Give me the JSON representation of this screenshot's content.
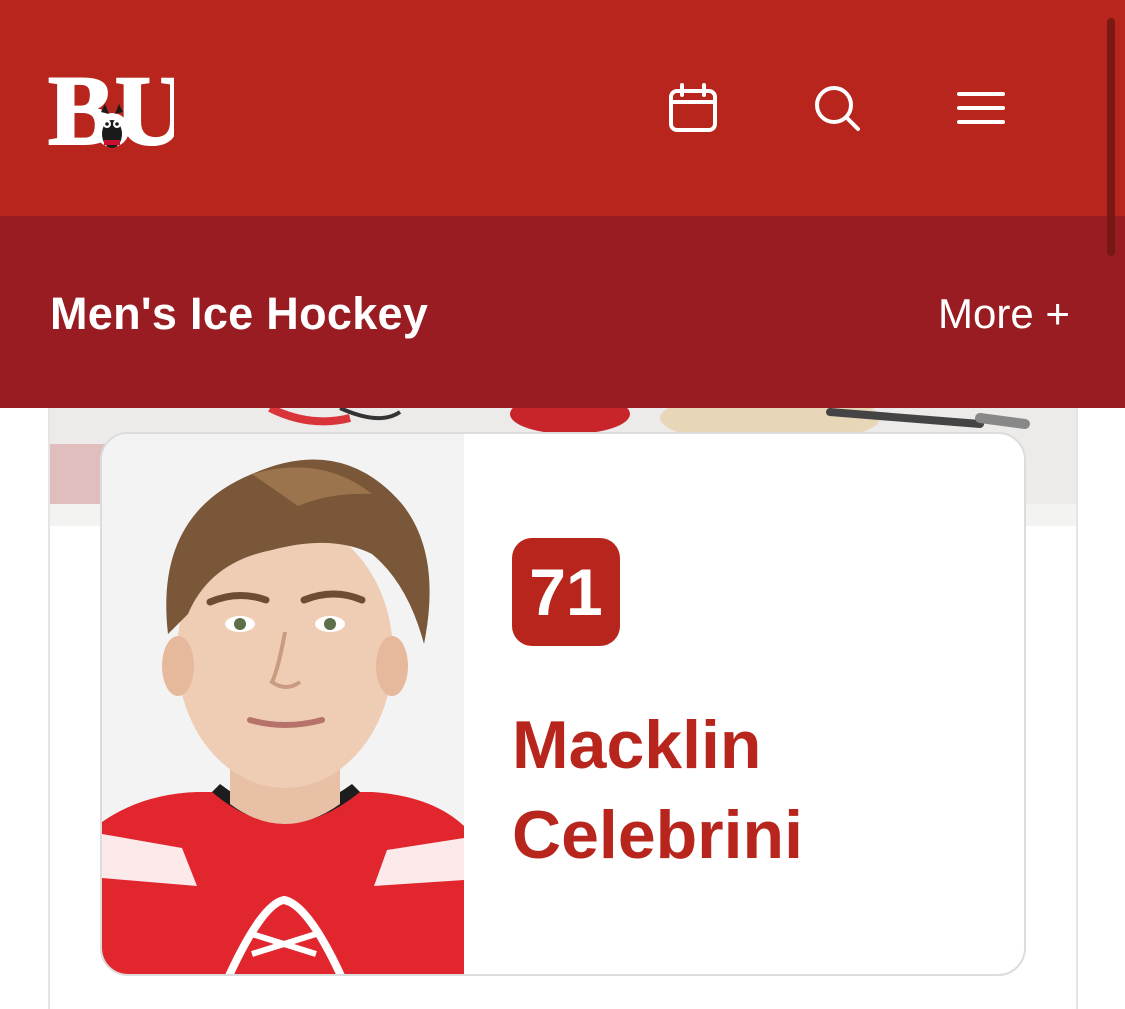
{
  "header": {
    "logo_text": "BU",
    "icons": [
      "calendar-icon",
      "search-icon",
      "menu-icon"
    ]
  },
  "sport_nav": {
    "title": "Men's Ice Hockey",
    "more_label": "More +"
  },
  "player": {
    "number": "71",
    "first_name": "Macklin",
    "last_name": "Celebrini"
  },
  "colors": {
    "brand_red": "#b8251c",
    "dark_red": "#981c21",
    "white": "#ffffff"
  }
}
